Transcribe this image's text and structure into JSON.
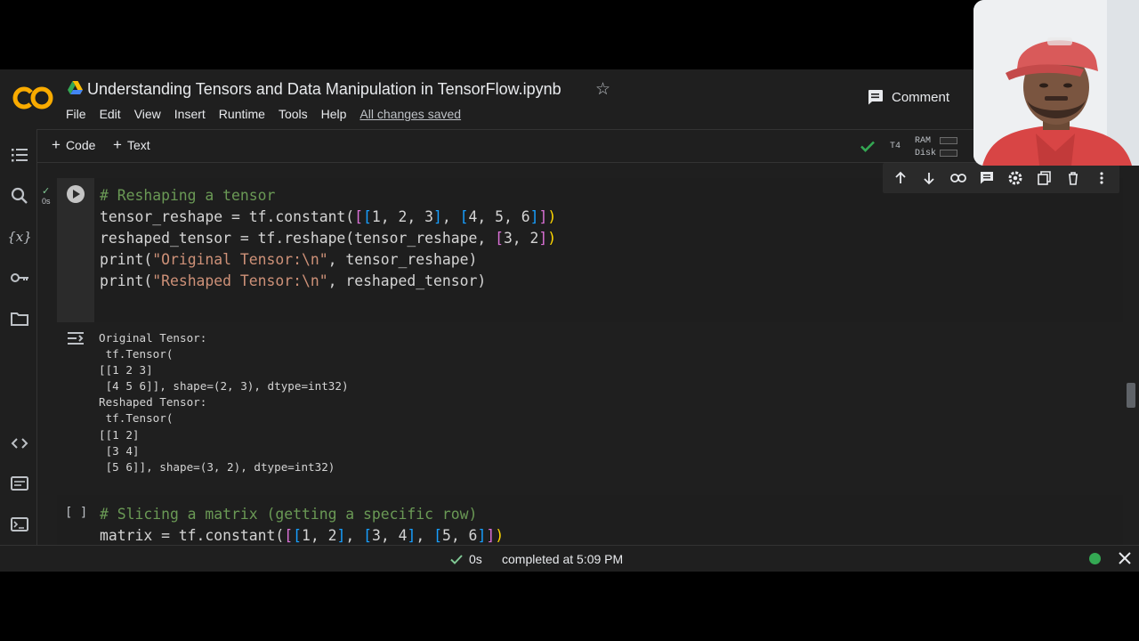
{
  "header": {
    "title": "Understanding Tensors and Data Manipulation in TensorFlow.ipynb",
    "logo_text": "CO",
    "menu": [
      "File",
      "Edit",
      "View",
      "Insert",
      "Runtime",
      "Tools",
      "Help"
    ],
    "save_status": "All changes saved",
    "comment_label": "Comment"
  },
  "toolbar": {
    "code_label": "Code",
    "text_label": "Text",
    "runtime_type": "T4",
    "ram_label": "RAM",
    "disk_label": "Disk"
  },
  "cell1": {
    "exec_time": "0s",
    "line1_comment": "# Reshaping a tensor",
    "line2_a": "tensor_reshape = tf.constant(",
    "line2_b": "([[",
    "line2_c": "1, 2, 3",
    "line2_d": "], [",
    "line2_e": "4, 5, 6",
    "line2_f": "]])",
    "line3_a": "reshaped_tensor = tf.reshape(tensor_reshape, ",
    "line3_b": "[",
    "line3_c": "3, 2",
    "line3_d": "])",
    "line4_a": "print(",
    "line4_str": "\"Original Tensor:\\n\"",
    "line4_b": ", tensor_reshape)",
    "line5_a": "print(",
    "line5_str": "\"Reshaped Tensor:\\n\"",
    "line5_b": ", reshaped_tensor)",
    "output": "Original Tensor:\n tf.Tensor(\n[[1 2 3]\n [4 5 6]], shape=(2, 3), dtype=int32)\nReshaped Tensor:\n tf.Tensor(\n[[1 2]\n [3 4]\n [5 6]], shape=(3, 2), dtype=int32)"
  },
  "cell2": {
    "bracket": "[ ]",
    "line1_comment": "# Slicing a matrix (getting a specific row)",
    "line2_a": "matrix = tf.constant(",
    "line2_b": "([[",
    "line2_c": "1, 2",
    "line2_d": "], [",
    "line2_e": "3, 4",
    "line2_f": "], [",
    "line2_g": "5, 6",
    "line2_h": "]])"
  },
  "statusbar": {
    "exec_time": "0s",
    "completed_text": "completed at 5:09 PM"
  },
  "colors": {
    "background": "#1f1f1f",
    "editor": "#1e1e1e",
    "comment": "#6a9955",
    "string": "#ce9178",
    "success": "#34a853",
    "logo_orange": "#f9ab00"
  }
}
